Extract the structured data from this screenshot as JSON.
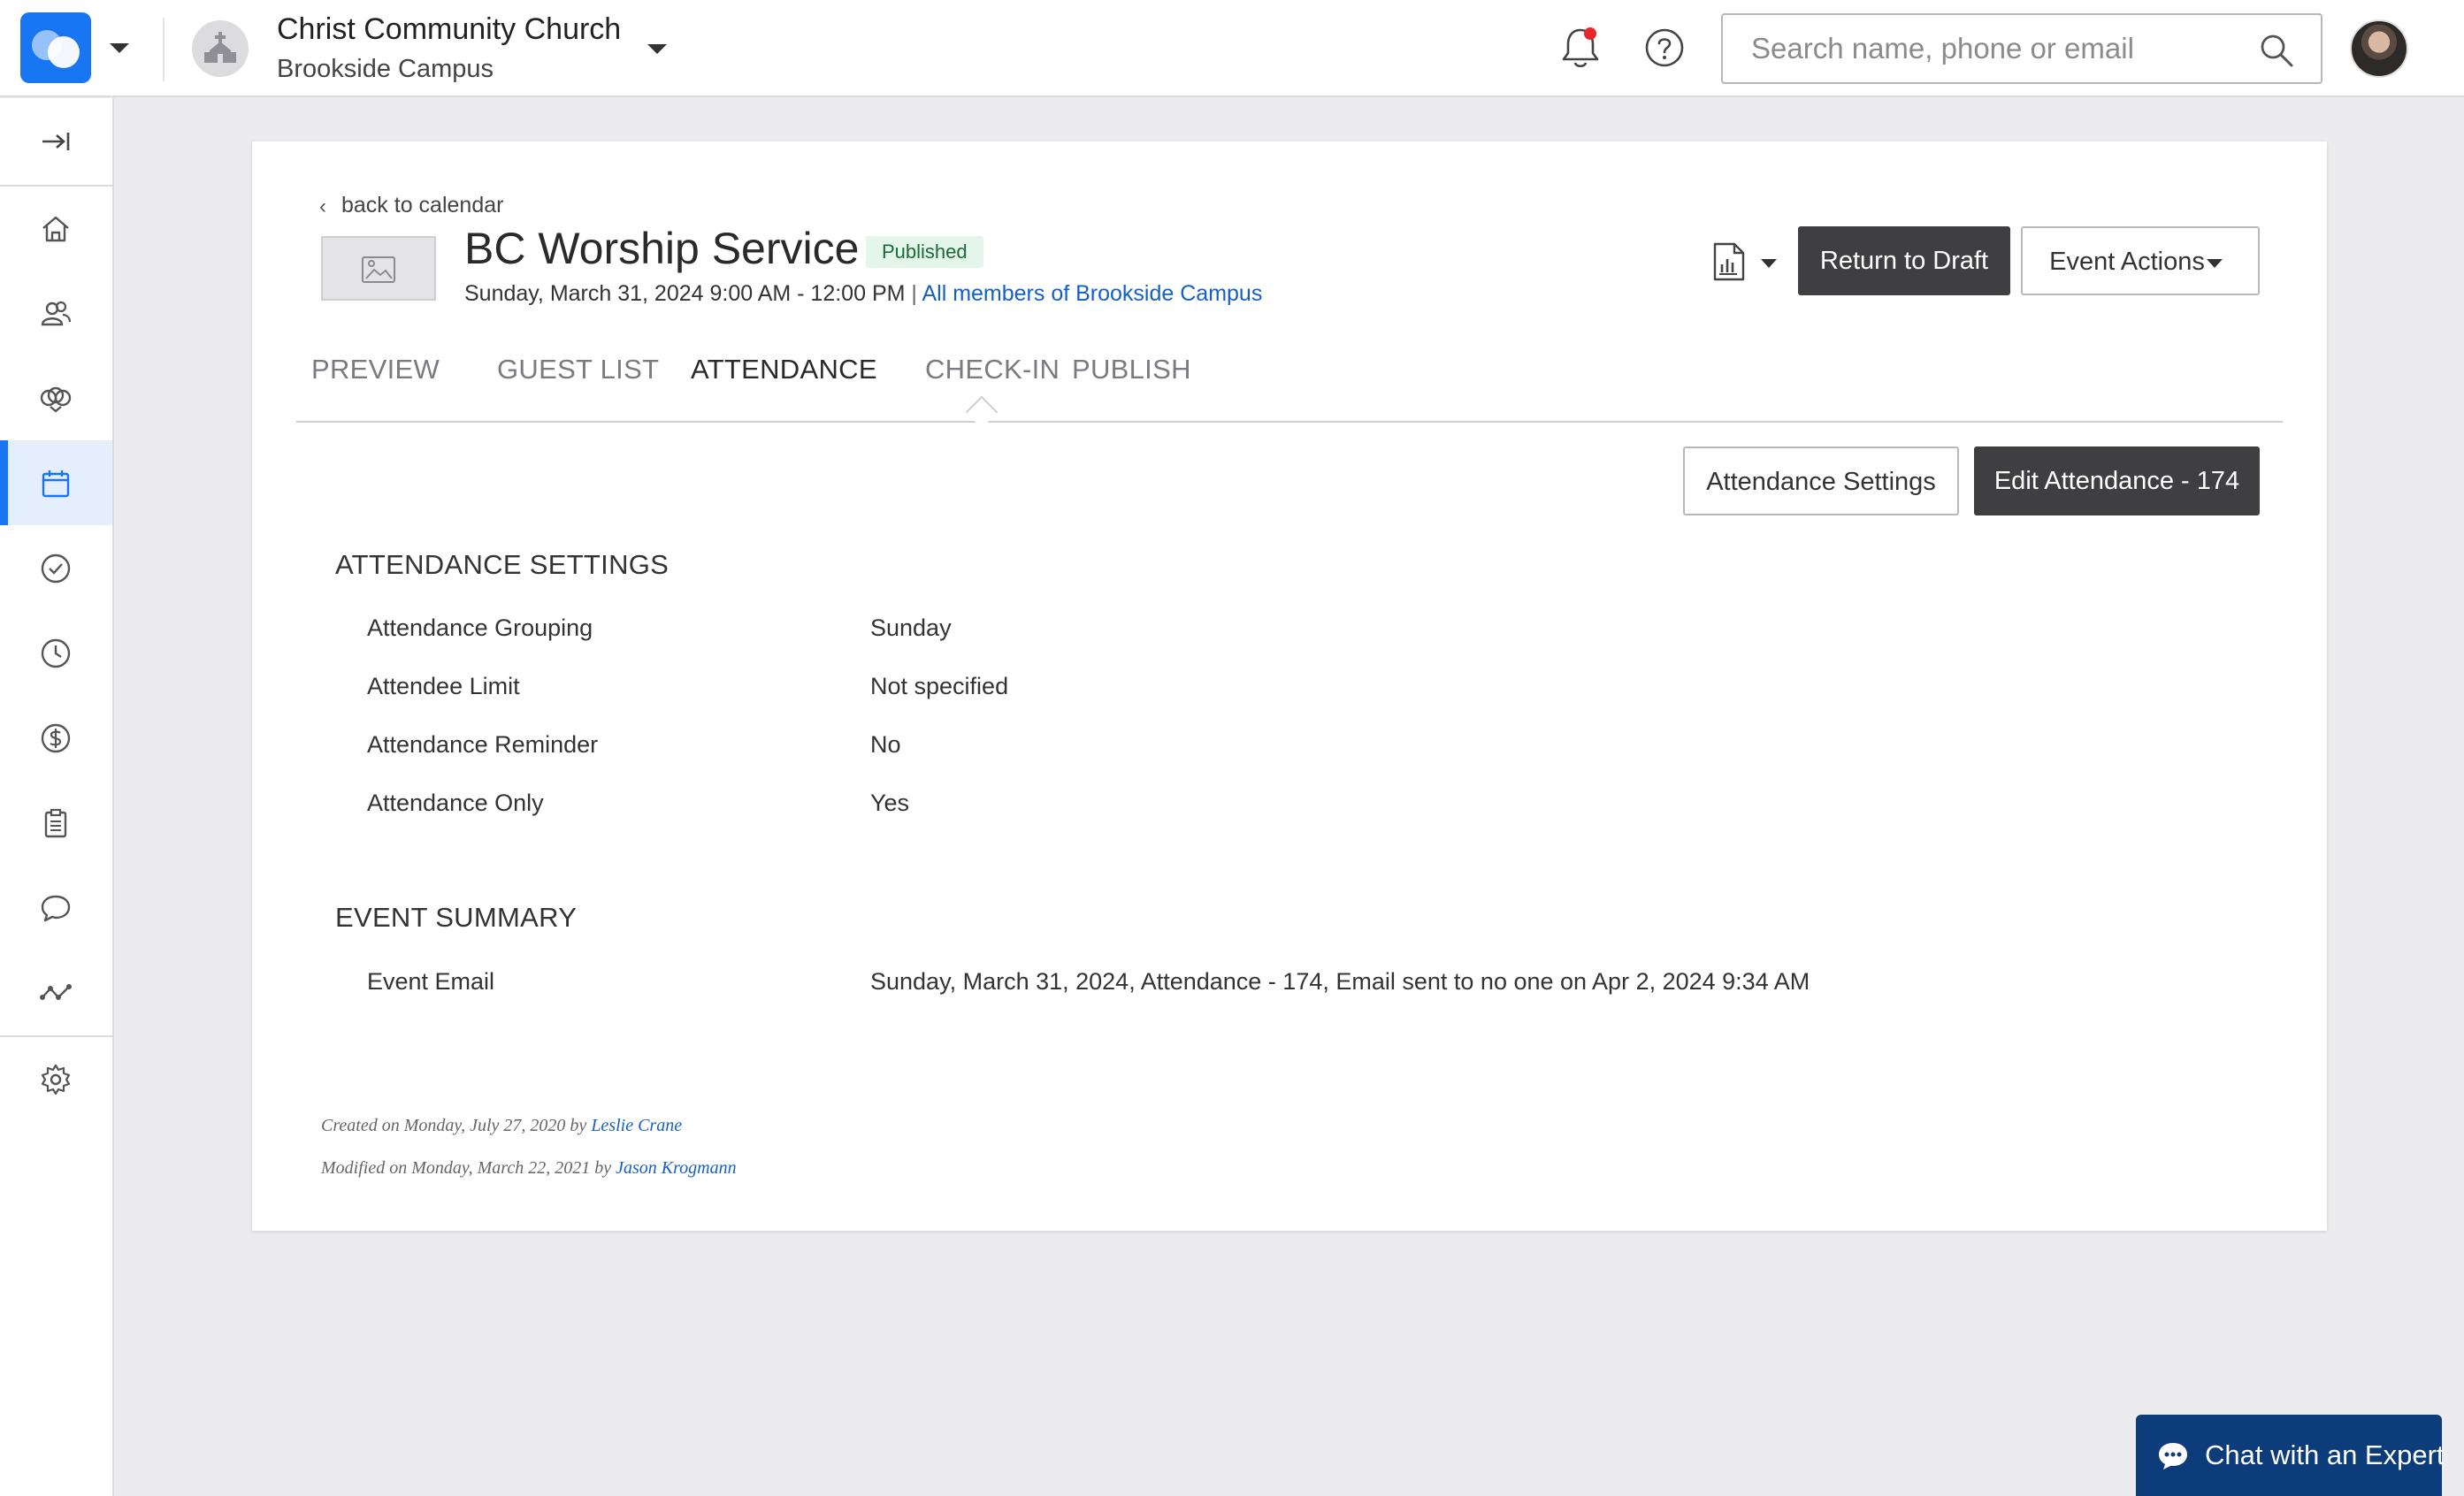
{
  "header": {
    "org_name": "Christ Community Church",
    "campus_name": "Brookside Campus",
    "search_placeholder": "Search name, phone or email",
    "notification_dot_color": "#e8262b"
  },
  "sidebar": {
    "items": [
      {
        "name": "home",
        "icon": "home-icon"
      },
      {
        "name": "people",
        "icon": "people-icon"
      },
      {
        "name": "groups",
        "icon": "groups-icon"
      },
      {
        "name": "events",
        "icon": "calendar-icon",
        "active": true
      },
      {
        "name": "tasks",
        "icon": "check-circle-icon"
      },
      {
        "name": "history",
        "icon": "clock-icon"
      },
      {
        "name": "giving",
        "icon": "dollar-icon"
      },
      {
        "name": "forms",
        "icon": "clipboard-icon"
      },
      {
        "name": "messages",
        "icon": "chat-icon"
      },
      {
        "name": "insights",
        "icon": "analytics-icon"
      },
      {
        "name": "settings",
        "icon": "gear-icon"
      }
    ],
    "active_color": "#1876f2"
  },
  "event": {
    "back_label": "back to calendar",
    "back_chevron": "‹",
    "title": "BC Worship Service",
    "status": "Published",
    "datetime": "Sunday, March 31, 2024 9:00 AM - 12:00 PM",
    "separator": "|",
    "audience_link": "All members of Brookside Campus",
    "return_to_draft_label": "Return to Draft",
    "event_actions_label": "Event Actions"
  },
  "tabs": [
    {
      "label": "PREVIEW",
      "active": false
    },
    {
      "label": "GUEST LIST",
      "active": false
    },
    {
      "label": "ATTENDANCE",
      "active": true
    },
    {
      "label": "CHECK-IN",
      "active": false
    },
    {
      "label": "PUBLISH",
      "active": false
    }
  ],
  "attendance": {
    "settings_button_label": "Attendance Settings",
    "edit_button_label": "Edit Attendance - 174",
    "settings_section_title": "ATTENDANCE SETTINGS",
    "settings_rows": [
      {
        "label": "Attendance Grouping",
        "value": "Sunday"
      },
      {
        "label": "Attendee Limit",
        "value": "Not specified"
      },
      {
        "label": "Attendance Reminder",
        "value": "No"
      },
      {
        "label": "Attendance Only",
        "value": "Yes"
      }
    ],
    "summary_section_title": "EVENT SUMMARY",
    "summary_rows": [
      {
        "label": "Event Email",
        "value": "Sunday, March 31, 2024, Attendance - 174, Email sent to no one on Apr 2, 2024 9:34 AM"
      }
    ]
  },
  "footer_meta": {
    "created_prefix": "Created on Monday, July 27, 2020 by",
    "created_by": "Leslie Crane",
    "modified_prefix": "Modified on Monday, March 22, 2021 by",
    "modified_by": "Jason Krogmann"
  },
  "chat": {
    "label": "Chat with an Expert",
    "background": "#0d3c7a"
  }
}
